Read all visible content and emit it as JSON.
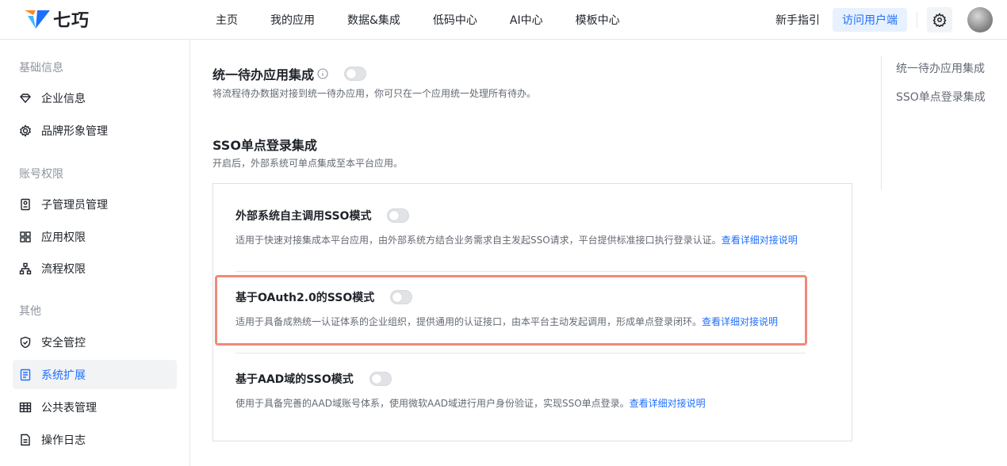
{
  "brand": {
    "name": "七巧"
  },
  "nav": {
    "items": [
      "主页",
      "我的应用",
      "数据&集成",
      "低码中心",
      "AI中心",
      "模板中心"
    ]
  },
  "header": {
    "guide": "新手指引",
    "visit_button": "访问用户端"
  },
  "sidebar": {
    "groups": [
      "基础信息",
      "账号权限",
      "其他"
    ],
    "items": [
      {
        "label": "企业信息",
        "icon": "diamond-icon"
      },
      {
        "label": "品牌形象管理",
        "icon": "gear-icon"
      },
      {
        "label": "子管理员管理",
        "icon": "badge-icon"
      },
      {
        "label": "应用权限",
        "icon": "grid-icon"
      },
      {
        "label": "流程权限",
        "icon": "org-chart-icon"
      },
      {
        "label": "安全管控",
        "icon": "shield-icon"
      },
      {
        "label": "系统扩展",
        "icon": "extension-doc-icon",
        "active": true
      },
      {
        "label": "公共表管理",
        "icon": "table-icon"
      },
      {
        "label": "操作日志",
        "icon": "log-doc-icon"
      }
    ]
  },
  "main": {
    "todo": {
      "title": "统一待办应用集成",
      "desc": "将流程待办数据对接到统一待办应用，你可只在一个应用统一处理所有待办。",
      "enabled": false
    },
    "sso": {
      "title": "SSO单点登录集成",
      "desc": "开启后，外部系统可单点集成至本平台应用。",
      "modes": [
        {
          "title": "外部系统自主调用SSO模式",
          "desc": "适用于快速对接集成本平台应用，由外部系统方结合业务需求自主发起SSO请求，平台提供标准接口执行登录认证。",
          "link": "查看详细对接说明",
          "enabled": false
        },
        {
          "title": "基于OAuth2.0的SSO模式",
          "desc": "适用于具备成熟统一认证体系的企业组织，提供通用的认证接口，由本平台主动发起调用，形成单点登录闭环。",
          "link": "查看详细对接说明",
          "enabled": false
        },
        {
          "title": "基于AAD域的SSO模式",
          "desc": "使用于具备完善的AAD域账号体系，使用微软AAD域进行用户身份验证，实现SSO单点登录。",
          "link": "查看详细对接说明",
          "enabled": false
        }
      ]
    }
  },
  "toc": {
    "items": [
      "统一待办应用集成",
      "SSO单点登录集成"
    ]
  },
  "colors": {
    "accent": "#1e6fff",
    "highlight": "#ef8a7a"
  }
}
